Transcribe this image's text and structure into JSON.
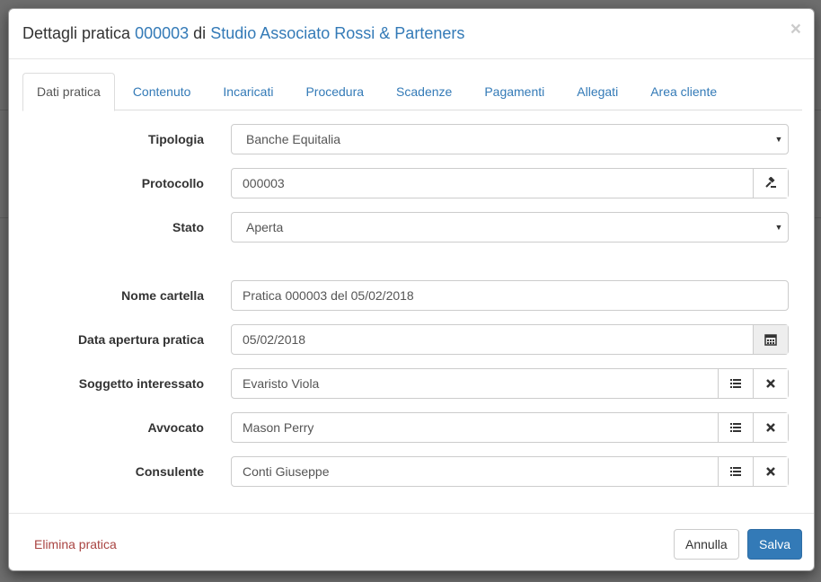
{
  "modal": {
    "title_prefix": "Dettagli pratica",
    "practice_number": "000003",
    "title_middle": "di",
    "studio_name": "Studio Associato Rossi & Parteners",
    "close_symbol": "×"
  },
  "tabs": [
    {
      "label": "Dati pratica",
      "active": true
    },
    {
      "label": "Contenuto",
      "active": false
    },
    {
      "label": "Incaricati",
      "active": false
    },
    {
      "label": "Procedura",
      "active": false
    },
    {
      "label": "Scadenze",
      "active": false
    },
    {
      "label": "Pagamenti",
      "active": false
    },
    {
      "label": "Allegati",
      "active": false
    },
    {
      "label": "Area cliente",
      "active": false
    }
  ],
  "form": {
    "tipologia": {
      "label": "Tipologia",
      "value": "Banche Equitalia"
    },
    "protocollo": {
      "label": "Protocollo",
      "value": "000003",
      "icon": "gavel-icon"
    },
    "stato": {
      "label": "Stato",
      "value": "Aperta"
    },
    "nome_cartella": {
      "label": "Nome cartella",
      "value": "Pratica 000003 del 05/02/2018"
    },
    "data_apertura": {
      "label": "Data apertura pratica",
      "value": "05/02/2018",
      "icon": "calendar-icon"
    },
    "soggetto": {
      "label": "Soggetto interessato",
      "value": "Evaristo Viola"
    },
    "avvocato": {
      "label": "Avvocato",
      "value": "Mason Perry"
    },
    "consulente": {
      "label": "Consulente",
      "value": "Conti Giuseppe"
    }
  },
  "footer": {
    "delete_label": "Elimina pratica",
    "cancel_label": "Annulla",
    "save_label": "Salva"
  },
  "colors": {
    "link": "#337ab7",
    "danger": "#a94442",
    "primary": "#337ab7"
  }
}
